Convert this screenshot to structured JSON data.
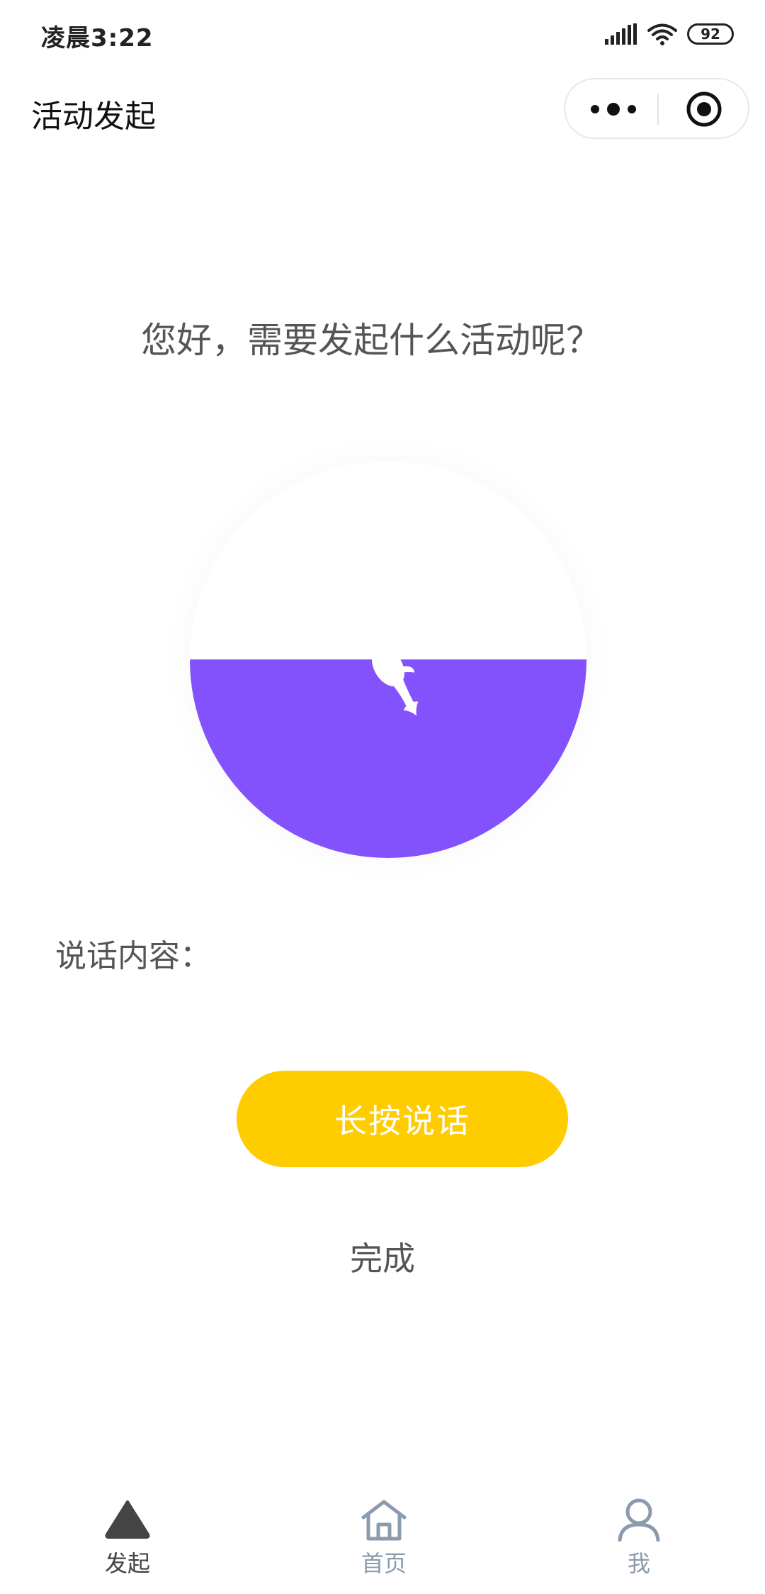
{
  "status_bar": {
    "time": "凌晨3:22",
    "battery": "92",
    "icons": [
      "signal-icon",
      "wifi-icon",
      "battery-icon"
    ]
  },
  "header": {
    "title": "活动发起",
    "more_icon": "more-dots-icon",
    "close_icon": "target-close-icon"
  },
  "main": {
    "greeting": "您好，需要发起什么活动呢？",
    "voice_wave": {
      "fill_color": "#8352fd",
      "fill_level": 0.5,
      "icon": "whale-icon"
    },
    "speech_label": "说话内容：",
    "speech_content": "",
    "hold_to_talk_label": "长按说话",
    "done_label": "完成"
  },
  "colors": {
    "accent_yellow": "#ffcc00",
    "wave_purple": "#8352fd",
    "tab_active": "#444444",
    "tab_inactive": "#8b9bac"
  },
  "tab_bar": {
    "items": [
      {
        "label": "发起",
        "icon": "triangle-icon",
        "active": true
      },
      {
        "label": "首页",
        "icon": "home-icon",
        "active": false
      },
      {
        "label": "我",
        "icon": "user-icon",
        "active": false
      }
    ]
  }
}
